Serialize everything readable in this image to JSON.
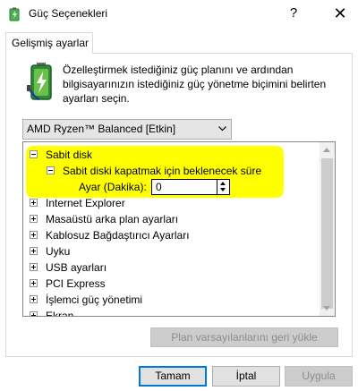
{
  "window": {
    "title": "Güç Seçenekleri",
    "help_glyph": "?",
    "close_glyph": "✕",
    "icon": "power-options-icon"
  },
  "tab": {
    "label": "Gelişmiş ayarlar"
  },
  "description": "Özelleştirmek istediğiniz güç planını ve ardından bilgisayarınızın istediğiniz güç yönetme biçimini belirten ayarları seçin.",
  "plan_select": {
    "value": "AMD Ryzen™ Balanced [Etkin]"
  },
  "tree": {
    "highlight_color": "#ffff00",
    "items": [
      {
        "label": "Sabit disk",
        "state": "expanded"
      },
      {
        "label": "Sabit diski kapatmak için beklenecek süre",
        "state": "expanded"
      },
      {
        "label": "Ayar (Dakika):",
        "value": "0"
      },
      {
        "label": "Internet Explorer",
        "state": "collapsed"
      },
      {
        "label": "Masaüstü arka plan ayarları",
        "state": "collapsed"
      },
      {
        "label": "Kablosuz Bağdaştırıcı Ayarları",
        "state": "collapsed"
      },
      {
        "label": "Uyku",
        "state": "collapsed"
      },
      {
        "label": "USB ayarları",
        "state": "collapsed"
      },
      {
        "label": "PCI Express",
        "state": "collapsed"
      },
      {
        "label": "İşlemci güç yönetimi",
        "state": "collapsed"
      },
      {
        "label": "Ekran",
        "state": "collapsed"
      }
    ]
  },
  "buttons": {
    "restore_defaults": "Plan varsayılanlarını geri yükle",
    "ok": "Tamam",
    "cancel": "İptal",
    "apply": "Uygula"
  }
}
